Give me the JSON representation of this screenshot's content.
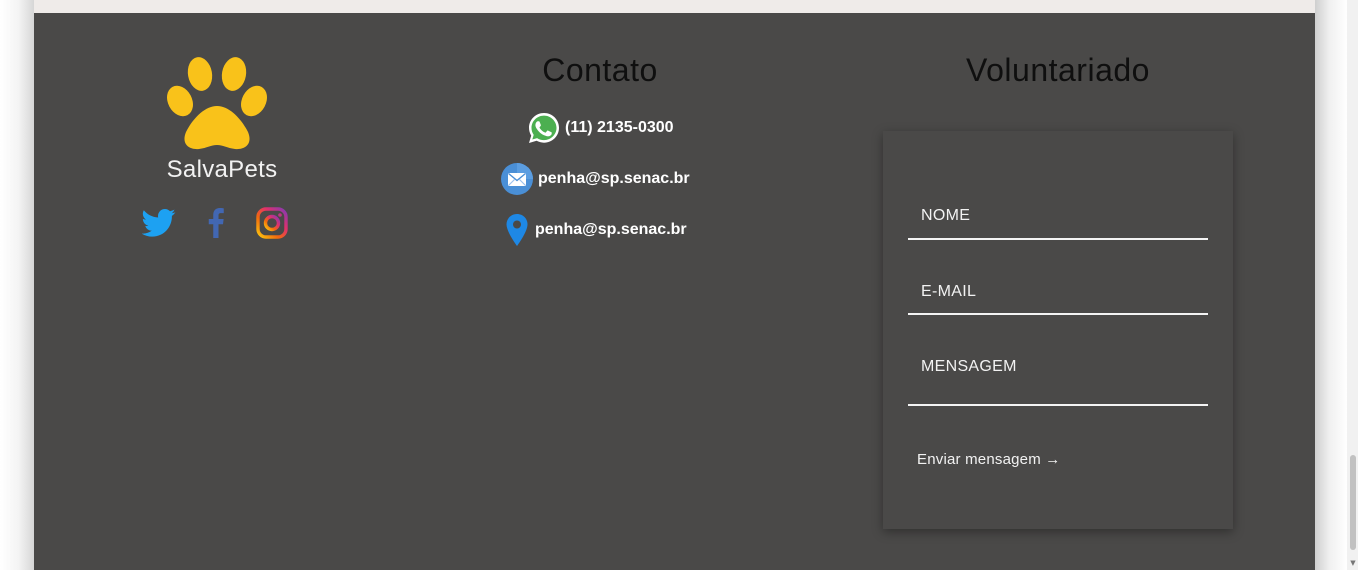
{
  "brand": {
    "name": "SalvaPets",
    "logo_icon": "paw-icon",
    "logo_color": "#f9c21a"
  },
  "social": [
    {
      "name": "twitter",
      "icon": "twitter-icon",
      "color": "#1da1f2"
    },
    {
      "name": "facebook",
      "icon": "facebook-icon",
      "color": "#4267b2"
    },
    {
      "name": "instagram",
      "icon": "instagram-icon",
      "color": "#e1306c"
    }
  ],
  "contact": {
    "title": "Contato",
    "phone": {
      "icon": "whatsapp-icon",
      "text": "(11) 2135-0300"
    },
    "email": {
      "icon": "mail-icon",
      "text": "penha@sp.senac.br"
    },
    "location": {
      "icon": "location-pin-icon",
      "text": "penha@sp.senac.br"
    }
  },
  "volunteer": {
    "title": "Voluntariado",
    "fields": {
      "name_label": "NOME",
      "email_label": "E-MAIL",
      "message_label": "MENSAGEM"
    },
    "send_label": "Enviar mensagem →"
  },
  "colors": {
    "footer_bg": "#4a4948",
    "title_text": "#0f0f0f",
    "body_text": "#ffffff"
  }
}
